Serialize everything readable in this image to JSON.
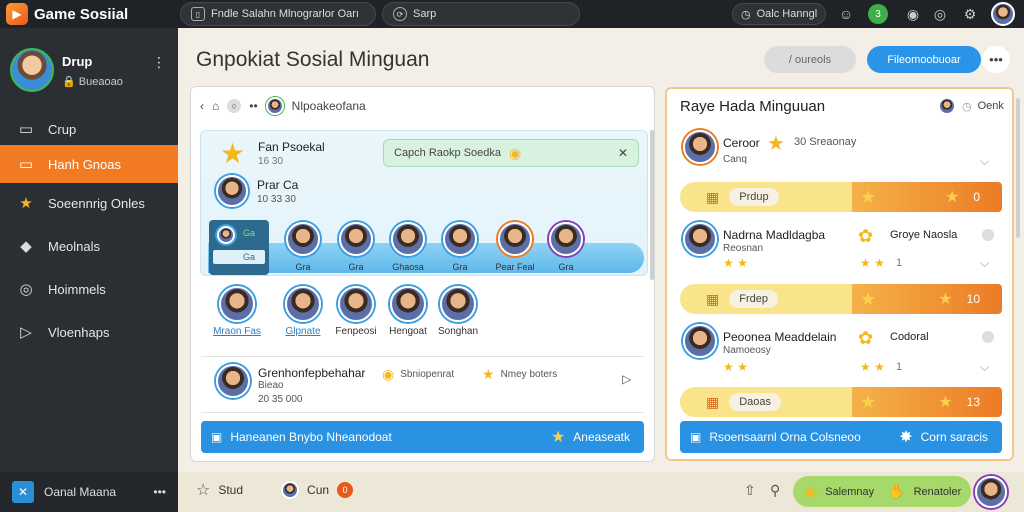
{
  "app": {
    "title": "Game Sosiial"
  },
  "topbar": {
    "tab1": "Fndle Salahn Mlnograrlor Oarı",
    "tab2": "Sarp",
    "user": "Oalc Hanngl",
    "badge": "3"
  },
  "sidebar": {
    "profile_name": "Drup",
    "profile_sub": "Bueaoao",
    "items": [
      {
        "label": "Crup",
        "icon": "window-icon"
      },
      {
        "label": "Hanh Gnoas",
        "icon": "group-icon",
        "active": true
      },
      {
        "label": "Soeennrig Onles",
        "icon": "trophy-icon"
      },
      {
        "label": "Meolnals",
        "icon": "chat-icon"
      },
      {
        "label": "Hoimmels",
        "icon": "settings-icon"
      },
      {
        "label": "Vloenhaps",
        "icon": "map-icon"
      }
    ],
    "bottom_label": "Oanal Maana"
  },
  "main": {
    "title": "Gnpokiat Sosial Minguan",
    "btn_secondary": "/ oureols",
    "btn_primary": "Fileomoobuoar"
  },
  "left_panel": {
    "header_name": "Nlpoakeofana",
    "chat": {
      "title": "Fan Psoekal",
      "time": "16 30",
      "bubble": "Capch Raokp Soedka",
      "sender": "Prar Ca",
      "sender_time": "10 33 30",
      "group_labels": [
        "Ga",
        "Ga"
      ]
    },
    "members_row1": [
      "Gra",
      "Gra",
      "Ghaosa",
      "Gra",
      "Pear Feal",
      "Gra"
    ],
    "members_row2": [
      "Mraon Fas",
      "Glpnate",
      "Fenpeosi",
      "Hengoat",
      "Songhan"
    ],
    "activity": {
      "title": "Grenhonfepbehahar",
      "sub": "Bieao",
      "time": "20 35 000",
      "tag1": "Sbniopenrat",
      "tag2": "Nmey boters"
    },
    "footer": "Haneanen Bnybo Nheanodoat",
    "footer_right": "Aneaseatk"
  },
  "right_panel": {
    "title": "Raye Hada Minguuan",
    "user": "Oenk",
    "rows": [
      {
        "name": "Ceroor",
        "stat": "30 Sreaonay",
        "sub": "Canq",
        "tag": "Prdup",
        "score": "0",
        "tail": ""
      },
      {
        "name": "Nadrna Madldagba",
        "stat": "Groye Naosla",
        "sub": "Reosnan",
        "tag": "Frdep",
        "score": "10",
        "tail": "1"
      },
      {
        "name": "Peoonea Meaddelain",
        "stat": "Codoral",
        "sub": "Namoeosy",
        "tag": "Daoas",
        "score": "13",
        "tail": "1"
      }
    ],
    "footer": "Rsoensaarnl Orna Colsneoo",
    "footer_right": "Corn saracis"
  },
  "bottombar": {
    "item1": "Stud",
    "item2": "Cun",
    "badge": "0",
    "pill1": "Salemnay",
    "pill2": "Renatoler"
  }
}
